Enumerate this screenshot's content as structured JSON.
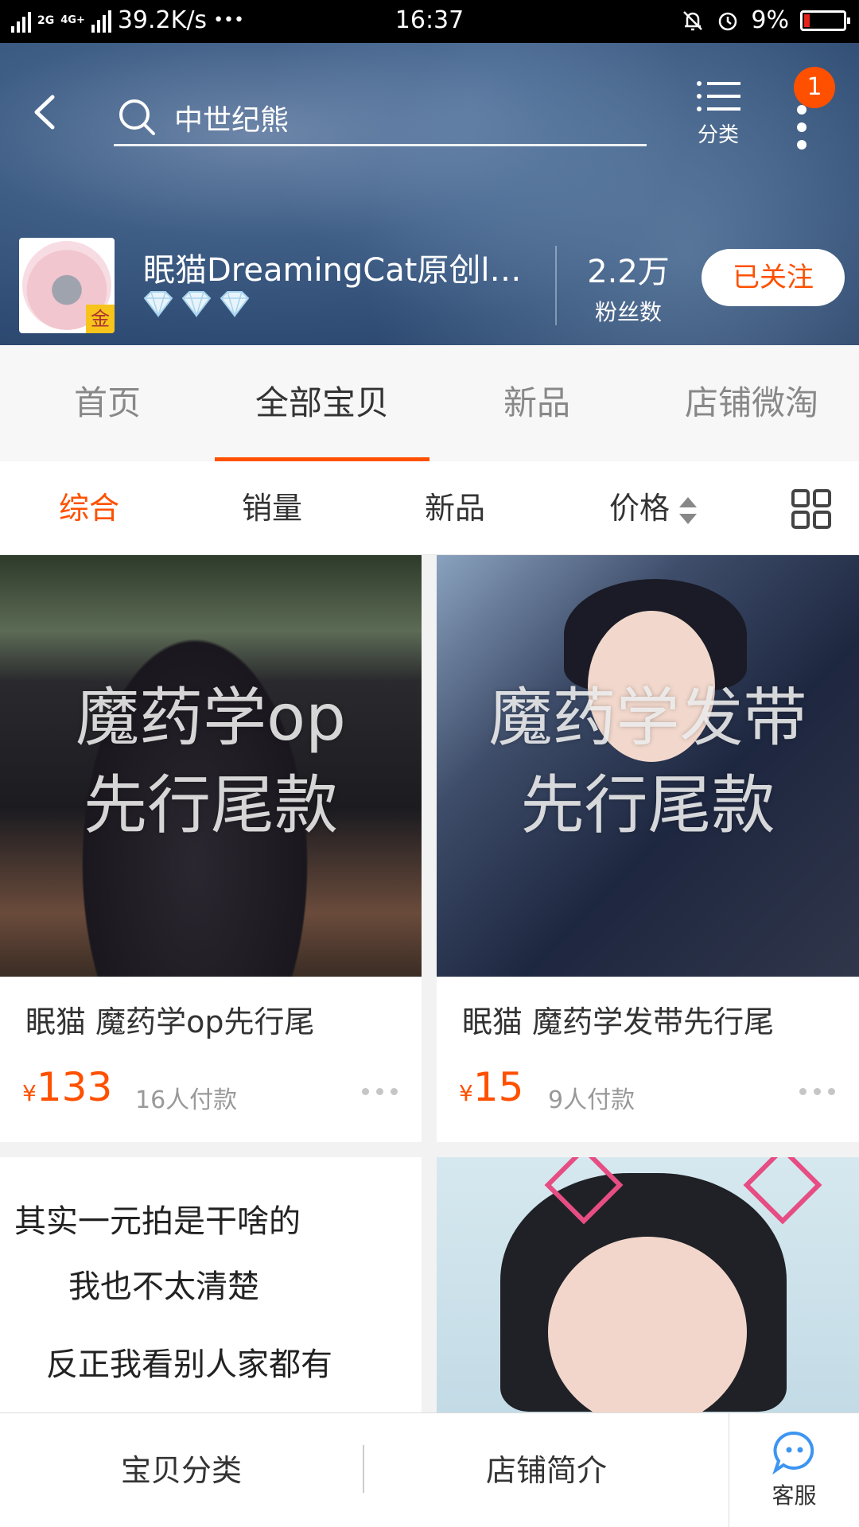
{
  "status_bar": {
    "network_1": "2G",
    "network_2": "4G+",
    "network_3": "4G+ 2G",
    "speed": "39.2K/s",
    "dots": "•••",
    "time": "16:37",
    "battery": "9%"
  },
  "header": {
    "search_query": "中世纪熊",
    "category_label": "分类",
    "notification_count": "1",
    "shop": {
      "name": "眠猫DreamingCat原创lolita",
      "badge": "金",
      "diamond_count": 3,
      "fans_count": "2.2万",
      "fans_label": "粉丝数",
      "follow_label": "已关注"
    }
  },
  "tabs": [
    {
      "label": "首页",
      "active": false
    },
    {
      "label": "全部宝贝",
      "active": true
    },
    {
      "label": "新品",
      "active": false
    },
    {
      "label": "店铺微淘",
      "active": false
    }
  ],
  "sort": {
    "items": [
      {
        "label": "综合",
        "active": true
      },
      {
        "label": "销量",
        "active": false
      },
      {
        "label": "新品",
        "active": false
      },
      {
        "label": "价格",
        "active": false
      }
    ]
  },
  "products": [
    {
      "overlay_line1": "魔药学op",
      "overlay_line2": "先行尾款",
      "title": "眠猫 魔药学op先行尾",
      "currency": "¥",
      "price": "133",
      "paid": "16人付款"
    },
    {
      "overlay_line1": "魔药学发带",
      "overlay_line2": "先行尾款",
      "title": "眠猫 魔药学发带先行尾",
      "currency": "¥",
      "price": "15",
      "paid": "9人付款"
    },
    {
      "note_line1": "其实一元拍是干啥的",
      "note_line2": "我也不太清楚",
      "note_line3": "反正我看别人家都有"
    },
    {}
  ],
  "bottom_bar": {
    "category": "宝贝分类",
    "intro": "店铺简介",
    "service": "客服"
  },
  "colors": {
    "accent": "#ff5000",
    "header_bg": "#2e4b73"
  }
}
